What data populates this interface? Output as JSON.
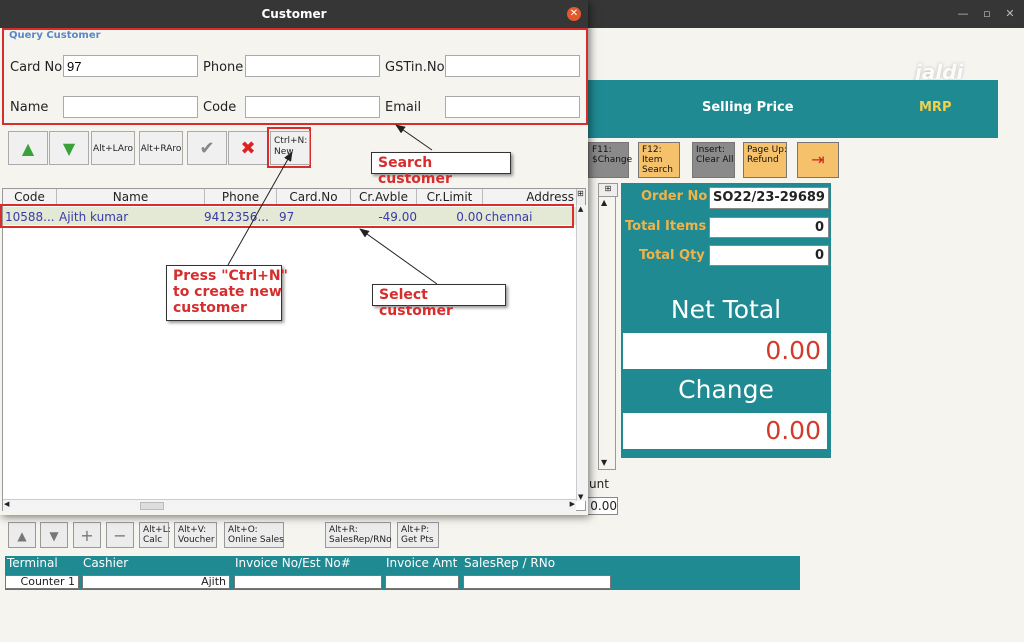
{
  "main_window": {
    "header": {
      "selling_price": "Selling Price",
      "mrp": "MRP"
    },
    "logo": "jaldi",
    "fkeys": [
      {
        "label": "F11:\n$Change"
      },
      {
        "label": "F12:\nItem\nSearch"
      },
      {
        "label": "Insert:\nClear All"
      },
      {
        "label": "Page Up:\nRefund"
      }
    ],
    "order": {
      "order_no_label": "Order No",
      "order_no": "SO22/23-29689",
      "total_items_label": "Total Items",
      "total_items": "0",
      "total_qty_label": "Total Qty",
      "total_qty": "0",
      "net_total_label": "Net Total",
      "net_total": "0.00",
      "change_label": "Change",
      "change": "0.00"
    },
    "partial_label": "unt",
    "partial_value": "0.00",
    "toolbar": [
      {
        "label": "Alt+L:\nCalc"
      },
      {
        "label": "Alt+V:\nVoucher"
      },
      {
        "label": "Alt+O:\nOnline Sales"
      },
      {
        "label": "Alt+R:\nSalesRep/RNo"
      },
      {
        "label": "Alt+P:\nGet Pts"
      }
    ],
    "bottom": {
      "terminal_label": "Terminal",
      "terminal": "Counter 1",
      "cashier_label": "Cashier",
      "cashier": "Ajith",
      "invoice_no_label": "Invoice No/Est No#",
      "invoice_amt_label": "Invoice Amt",
      "salesrep_label": "SalesRep / RNo"
    }
  },
  "dialog": {
    "title": "Customer",
    "query": {
      "legend": "Query Customer",
      "card_no_label": "Card No",
      "card_no": "97",
      "phone_label": "Phone",
      "phone": "",
      "gstin_label": "GSTin.No",
      "gstin": "",
      "name_label": "Name",
      "name": "",
      "code_label": "Code",
      "code": "",
      "email_label": "Email",
      "email": ""
    },
    "buttons": {
      "alt_left": "Alt+LAro",
      "alt_right": "Alt+RAro",
      "new": "Ctrl+N:\nNew"
    },
    "columns": [
      "Code",
      "Name",
      "Phone",
      "Card.No",
      "Cr.Avble",
      "Cr.Limit",
      "Address"
    ],
    "rows": [
      {
        "code": "10588...",
        "name": "Ajith kumar",
        "phone": "9412356...",
        "card_no": "97",
        "cr_avble": "-49.00",
        "cr_limit": "0.00",
        "address": "chennai"
      }
    ]
  },
  "annotations": {
    "search": "Search customer",
    "select": "Select customer",
    "new": "Press \"Ctrl+N\"\nto create new\ncustomer"
  }
}
